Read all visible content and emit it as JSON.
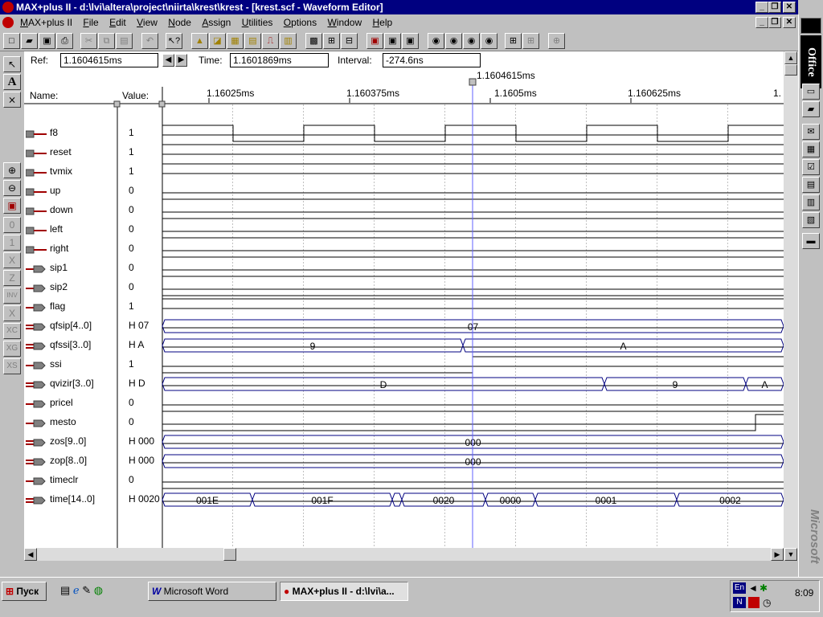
{
  "window": {
    "title": "MAX+plus II - d:\\lvi\\altera\\project\\niirta\\krest\\krest - [krest.scf - Waveform Editor]",
    "buttons": {
      "minimize": "_",
      "restore": "❐",
      "close": "✕"
    }
  },
  "menu": [
    "MAX+plus II",
    "File",
    "Edit",
    "View",
    "Node",
    "Assign",
    "Utilities",
    "Options",
    "Window",
    "Help"
  ],
  "toolbar": {
    "icons": [
      "new-file-icon",
      "open-file-icon",
      "save-icon",
      "print-icon",
      "cut-icon",
      "copy-icon",
      "paste-icon",
      "undo-icon",
      "help-pointer-icon",
      "hierarchy-up-icon",
      "floorplan-icon",
      "symbol-editor-icon",
      "text-editor-icon",
      "waveform-editor-icon",
      "compile-icon",
      "simulate-icon",
      "timing-analyzer-icon",
      "programmer-icon",
      "project-save-check-icon",
      "project-save-compile-icon",
      "project-save-simulate-icon",
      "view-eye-a-icon",
      "view-eye-ab-icon",
      "view-eye-c-icon",
      "view-eye-d-icon",
      "grid-icon",
      "grid-alt-icon",
      "zoom-fit-icon"
    ]
  },
  "info": {
    "ref_label": "Ref:",
    "ref_value": "1.1604615ms",
    "time_label": "Time:",
    "time_value": "1.1601869ms",
    "interval_label": "Interval:",
    "interval_value": "-274.6ns",
    "cursor_label": "1.1604615ms"
  },
  "header": {
    "name_label": "Name:",
    "value_label": "Value:",
    "time_ticks": [
      "1.16025ms",
      "1.160375ms",
      "1.1605ms",
      "1.160625ms",
      "1."
    ]
  },
  "signals": [
    {
      "name": "f8",
      "value": "1",
      "pin": "input"
    },
    {
      "name": "reset",
      "value": "1",
      "pin": "input"
    },
    {
      "name": "tvmix",
      "value": "1",
      "pin": "input"
    },
    {
      "name": "up",
      "value": "0",
      "pin": "input"
    },
    {
      "name": "down",
      "value": "0",
      "pin": "input"
    },
    {
      "name": "left",
      "value": "0",
      "pin": "input"
    },
    {
      "name": "right",
      "value": "0",
      "pin": "input"
    },
    {
      "name": "sip1",
      "value": "0",
      "pin": "output"
    },
    {
      "name": "sip2",
      "value": "0",
      "pin": "output"
    },
    {
      "name": "flag",
      "value": "1",
      "pin": "output"
    },
    {
      "name": "qfsip[4..0]",
      "value": "H 07",
      "pin": "bus"
    },
    {
      "name": "qfssi[3..0]",
      "value": "H A",
      "pin": "bus"
    },
    {
      "name": "ssi",
      "value": "1",
      "pin": "output"
    },
    {
      "name": "qvizir[3..0]",
      "value": "H D",
      "pin": "bus"
    },
    {
      "name": "pricel",
      "value": "0",
      "pin": "output"
    },
    {
      "name": "mesto",
      "value": "0",
      "pin": "output"
    },
    {
      "name": "zos[9..0]",
      "value": "H 000",
      "pin": "bus"
    },
    {
      "name": "zop[8..0]",
      "value": "H 000",
      "pin": "bus"
    },
    {
      "name": "timeclr",
      "value": "0",
      "pin": "output"
    },
    {
      "name": "time[14..0]",
      "value": "H 0020",
      "pin": "bus"
    }
  ],
  "bus_labels": {
    "qfsip": [
      "07"
    ],
    "qfssi": [
      "9",
      "A"
    ],
    "qvizir": [
      "D",
      "9",
      "A"
    ],
    "zos": [
      "000"
    ],
    "zop": [
      "000"
    ],
    "time": [
      "001E",
      "001F",
      "0020",
      "0000",
      "0001",
      "0002"
    ]
  },
  "office_bar": {
    "title": "Office",
    "vendor": "Microsoft"
  },
  "taskbar": {
    "start_label": "Пуск",
    "tasks": [
      "Microsoft Word",
      "MAX+plus II - d:\\lvi\\a..."
    ],
    "tray_lang": "En",
    "clock": "8:09"
  },
  "colors": {
    "title_bg": "#000080",
    "bus_text": "#000080",
    "cursor_line": "#6060ff"
  }
}
